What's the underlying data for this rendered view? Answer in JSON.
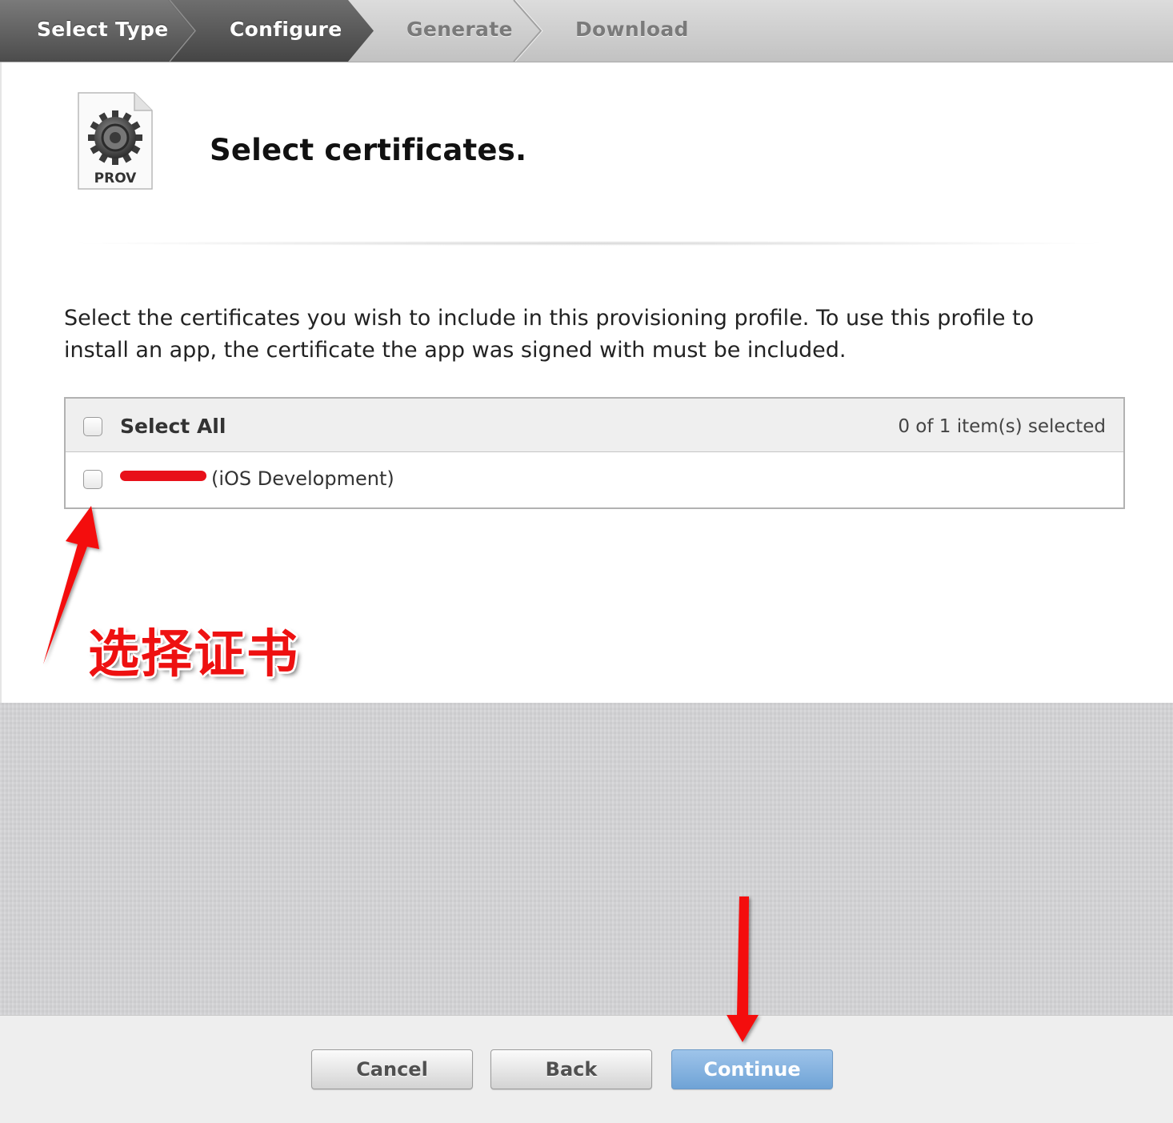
{
  "steps": [
    {
      "label": "Select Type",
      "state": "completed"
    },
    {
      "label": "Configure",
      "state": "current"
    },
    {
      "label": "Generate",
      "state": "upcoming"
    },
    {
      "label": "Download",
      "state": "upcoming"
    }
  ],
  "file_icon": {
    "label": "PROV",
    "icon": "gear-document-icon"
  },
  "page": {
    "title": "Select certificates.",
    "description": "Select the certificates you wish to include in this provisioning profile. To use this profile to install an app, the certificate the app was signed with must be included."
  },
  "certificates": {
    "select_all_label": "Select All",
    "selection_status": "0 of 1 item(s) selected",
    "items": [
      {
        "name_suffix": "(iOS Development)",
        "checked": false
      }
    ]
  },
  "annotation": {
    "text": "选择证书",
    "color": "#ee1111"
  },
  "buttons": {
    "cancel": "Cancel",
    "back": "Back",
    "continue": "Continue"
  },
  "colors": {
    "primary_button": "#7fb0e0",
    "active_step": "#595959"
  }
}
